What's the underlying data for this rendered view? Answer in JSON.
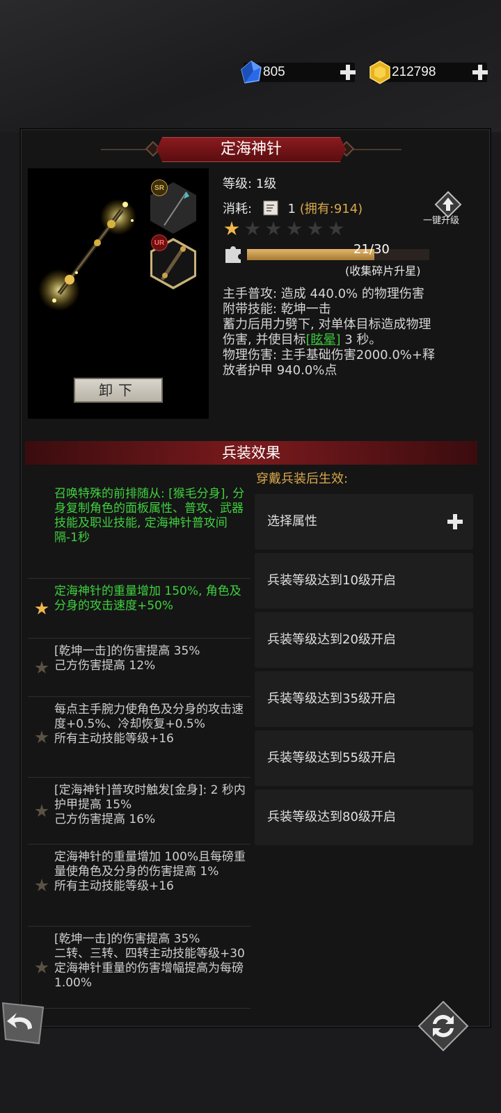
{
  "currencies": [
    {
      "name": "blue-gem",
      "value": "805",
      "color": "#2f6fe0"
    },
    {
      "name": "gold-gem",
      "value": "212798",
      "color": "#e0b020"
    }
  ],
  "item": {
    "title": "定海神针",
    "level_label": "等级: 1级",
    "cost_label": "消耗:",
    "cost_count": "1",
    "cost_owned": "(拥有:914)",
    "stars_total": 6,
    "stars_lit": 1,
    "shards_current": 21,
    "shards_max": 30,
    "shards_text": "21/30",
    "shards_hint": "(收集碎片升星)",
    "upgrade_label": "一键升级",
    "badge_sr": "SR",
    "badge_ur": "UR",
    "unequip_label": "卸下",
    "desc": {
      "line1": "主手普攻: 造成 440.0% 的物理伤害",
      "line2": "附带技能: 乾坤一击",
      "line3": "蓄力后用力劈下, 对单体目标造成物理",
      "line4_pre": "伤害, 并使目标",
      "line4_link": "[眩晕]",
      "line4_post": " 3 秒。",
      "line5": "物理伤害: 主手基础伤害2000.0%+释",
      "line6": "放者护甲 940.0%点"
    }
  },
  "effects": {
    "header": "兵装效果",
    "sub": "穿戴兵装后生效:",
    "list": [
      {
        "text": "召唤特殊的前排随从: [猴毛分身], 分身复制角色的面板属性、普攻、武器技能及职业技能, 定海神针普攻间隔-1秒",
        "active": true,
        "star": false
      },
      {
        "text": "定海神针的重量增加 150%, 角色及分身的攻击速度+50%",
        "active": true,
        "star": true
      },
      {
        "text": "[乾坤一击]的伤害提高 35%\n己方伤害提高 12%",
        "active": false,
        "star": true
      },
      {
        "text": "每点主手腕力使角色及分身的攻击速度+0.5%、冷却恢复+0.5%\n所有主动技能等级+16",
        "active": false,
        "star": true
      },
      {
        "text": "[定海神针]普攻时触发[金身]: 2 秒内护甲提高 15%\n己方伤害提高 16%",
        "active": false,
        "star": true
      },
      {
        "text": "定海神针的重量增加 100%且每磅重量使角色及分身的伤害提高 1%\n所有主动技能等级+16",
        "active": false,
        "star": true
      },
      {
        "text": "[乾坤一击]的伤害提高 35%\n二转、三转、四转主动技能等级+30\n定海神针重量的伤害增幅提高为每磅 1.00%",
        "active": false,
        "star": true
      }
    ],
    "slots": [
      {
        "label": "选择属性",
        "plus": true
      },
      {
        "label": "兵装等级达到10级开启",
        "plus": false
      },
      {
        "label": "兵装等级达到20级开启",
        "plus": false
      },
      {
        "label": "兵装等级达到35级开启",
        "plus": false
      },
      {
        "label": "兵装等级达到55级开启",
        "plus": false
      },
      {
        "label": "兵装等级达到80级开启",
        "plus": false
      }
    ]
  },
  "icons": {
    "back": "back-arrow-icon",
    "swap": "swap-icon",
    "shard": "puzzle-piece-icon",
    "scroll": "scroll-icon"
  }
}
